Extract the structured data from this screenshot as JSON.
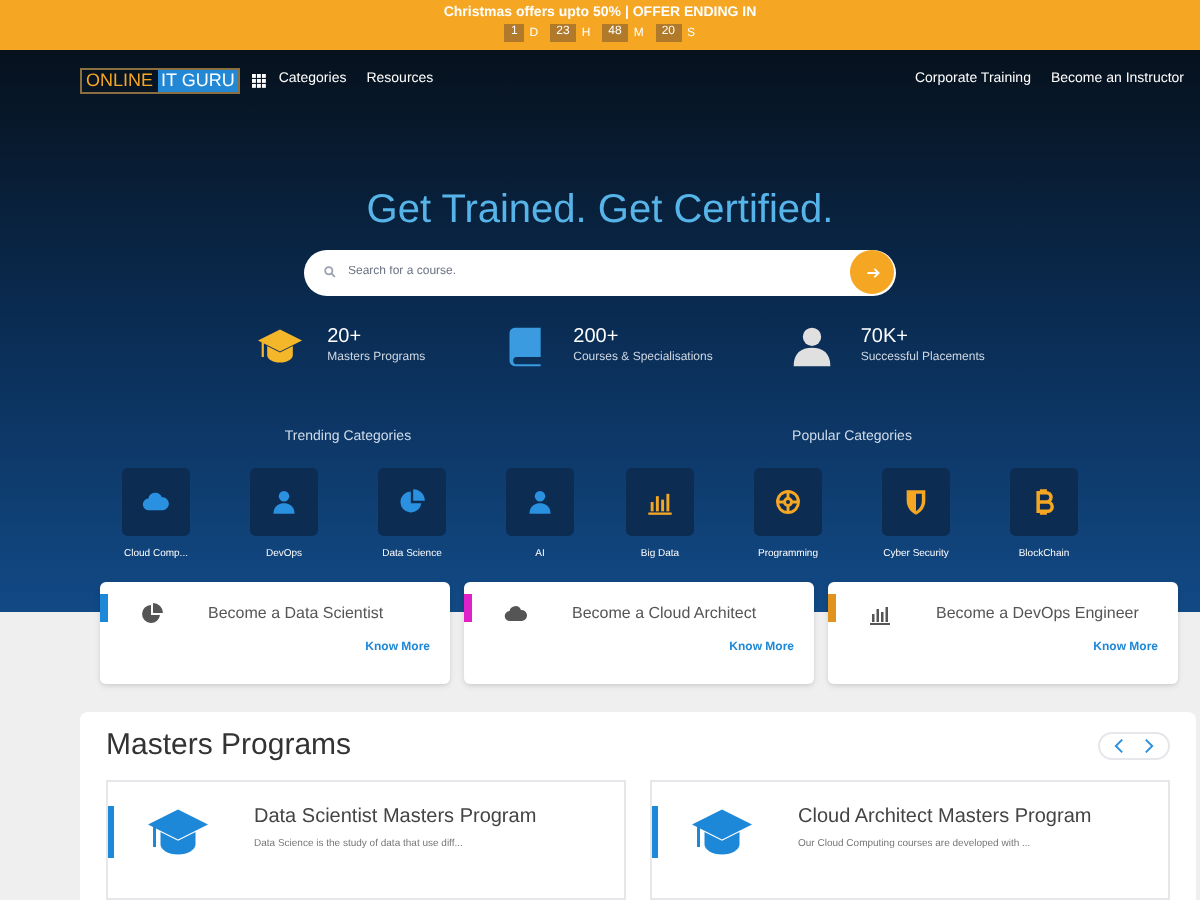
{
  "promo_banner": {
    "text": "Christmas offers upto 50% | OFFER ENDING IN",
    "countdown": [
      {
        "value": "1",
        "unit": "D"
      },
      {
        "value": "23",
        "unit": "H"
      },
      {
        "value": "48",
        "unit": "M"
      },
      {
        "value": "20",
        "unit": "S"
      }
    ]
  },
  "nav": {
    "logo": [
      "ONLINE",
      "IT GURU"
    ],
    "left_links": [
      "Categories",
      "Resources"
    ],
    "right_links": [
      "Corporate Training",
      "Become an Instructor"
    ]
  },
  "hero": {
    "title": "Get Trained. Get Certified.",
    "search": {
      "placeholder": "Search for a course."
    },
    "stats": [
      {
        "kind": "cap",
        "value": "20+",
        "label": "Masters Programs"
      },
      {
        "kind": "book",
        "value": "200+",
        "label": "Courses & Specialisations"
      },
      {
        "kind": "person",
        "value": "70K+",
        "label": "Successful Placements"
      }
    ]
  },
  "category_groups": [
    {
      "title": "Trending Categories",
      "items": [
        {
          "kind": "cloud",
          "label": "Cloud Comp..."
        },
        {
          "kind": "user",
          "label": "DevOps"
        },
        {
          "kind": "pie",
          "label": "Data Science"
        },
        {
          "kind": "user",
          "label": "AI"
        }
      ]
    },
    {
      "title": "Popular Categories",
      "items": [
        {
          "kind": "bars",
          "label": "Big Data"
        },
        {
          "kind": "hub",
          "label": "Programming"
        },
        {
          "kind": "shield",
          "label": "Cyber Security"
        },
        {
          "kind": "bitcoin",
          "label": "BlockChain"
        }
      ]
    }
  ],
  "career_cards": [
    {
      "kind": "pie",
      "title": "Become a Data Scientist",
      "link": "Know More",
      "color": "#1e88d8"
    },
    {
      "kind": "cloud",
      "title": "Become a Cloud Architect",
      "link": "Know More",
      "color": "#e020c8"
    },
    {
      "kind": "bars",
      "title": "Become a DevOps Engineer",
      "link": "Know More",
      "color": "#e0941e"
    }
  ],
  "masters": {
    "title": "Masters Programs",
    "programs": [
      {
        "title": "Data Scientist Masters Program",
        "description": "Data Science is the study of data that use diff..."
      },
      {
        "title": "Cloud Architect Masters Program",
        "description": "Our Cloud Computing courses are developed with ..."
      }
    ]
  }
}
